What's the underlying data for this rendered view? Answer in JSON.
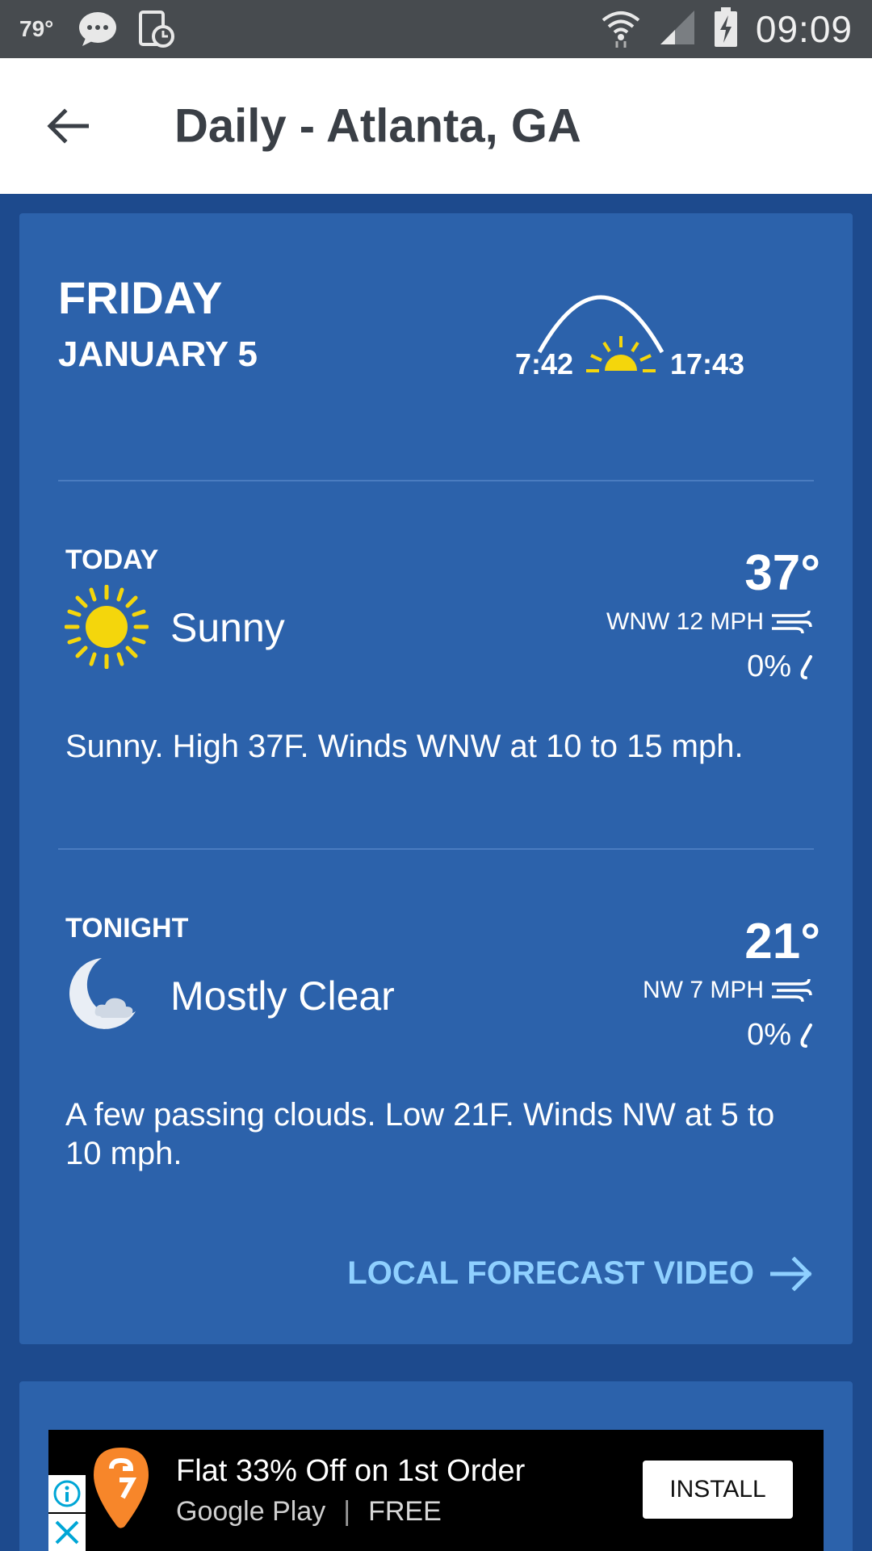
{
  "status_bar": {
    "temperature": "79°",
    "time": "09:09",
    "icons": [
      "chat-bubble-icon",
      "device-clock-icon",
      "wifi-icon",
      "signal-icon",
      "battery-charging-icon"
    ]
  },
  "app_bar": {
    "title": "Daily - Atlanta, GA",
    "back_icon": "arrow-back-icon"
  },
  "day": {
    "name": "FRIDAY",
    "date": "JANUARY 5",
    "sunrise": "7:42",
    "sunset": "17:43"
  },
  "periods": [
    {
      "label": "TODAY",
      "icon": "sun-icon",
      "condition": "Sunny",
      "temp": "37°",
      "wind": "WNW 12 MPH",
      "precip": "0%",
      "description": "Sunny. High 37F. Winds WNW at 10 to 15 mph."
    },
    {
      "label": "TONIGHT",
      "icon": "moon-cloud-icon",
      "condition": "Mostly Clear",
      "temp": "21°",
      "wind": "NW 7 MPH",
      "precip": "0%",
      "description": "A few passing clouds. Low 21F. Winds NW at 5 to 10 mph."
    }
  ],
  "video_link": {
    "label": "LOCAL FORECAST VIDEO"
  },
  "ad": {
    "title": "Flat 33% Off on 1st Order",
    "store": "Google Play",
    "price": "FREE",
    "button": "INSTALL"
  },
  "colors": {
    "background": "#1d4a8d",
    "card": "#2c62ab",
    "link": "#8fd0ff",
    "sun": "#f4d60c"
  }
}
